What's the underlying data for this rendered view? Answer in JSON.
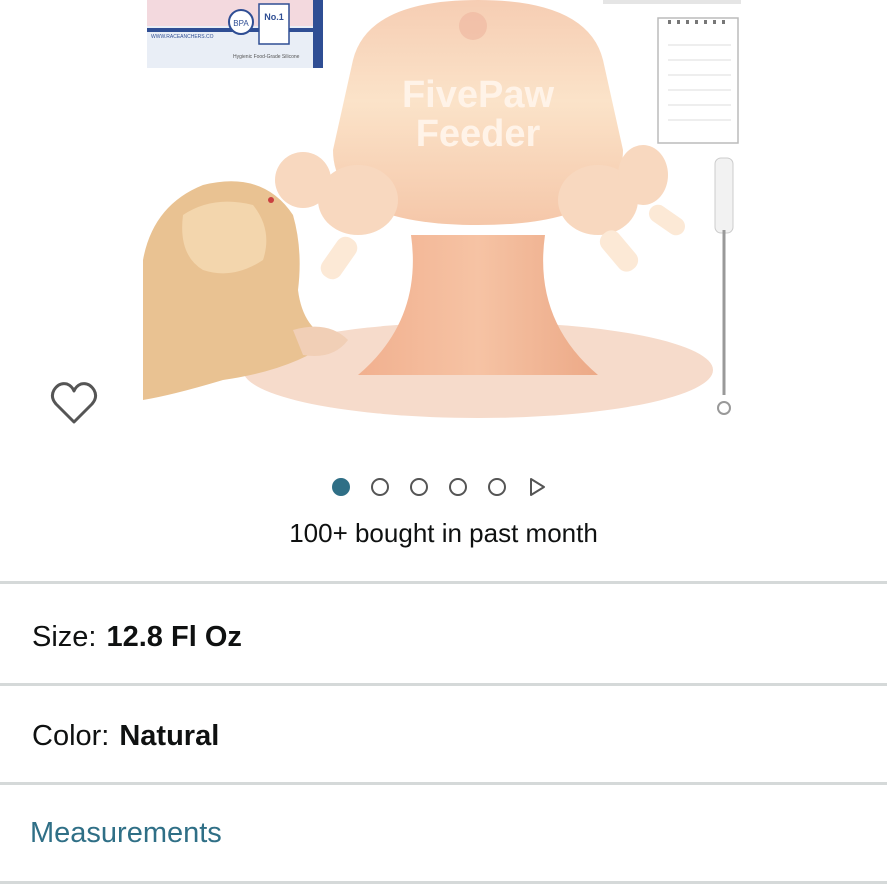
{
  "gallery": {
    "product_brand_text_line1": "FivePaw",
    "product_brand_text_line2": "Feeder",
    "box_text_no1": "No.1",
    "box_text_bpa": "BPA",
    "box_text_url": "WWW.RACEANCHERS.CO",
    "box_text_silicone": "Hygienic Food-Grade Silicone",
    "image_count": 5,
    "active_index": 0
  },
  "social_proof": {
    "bought_text": "100+ bought in past month"
  },
  "variations": {
    "size": {
      "label": "Size:",
      "value": "12.8 Fl Oz"
    },
    "color": {
      "label": "Color:",
      "value": "Natural"
    }
  },
  "measurements": {
    "label": "Measurements"
  },
  "colors": {
    "link": "#2f6f86",
    "active_dot": "#2f6f86",
    "divider": "#d5d9d9",
    "feeder": "#f9d3b8",
    "feeder_stand": "#f2b394"
  },
  "icons": {
    "wishlist": "heart-outline-icon",
    "next": "play-triangle-icon"
  }
}
